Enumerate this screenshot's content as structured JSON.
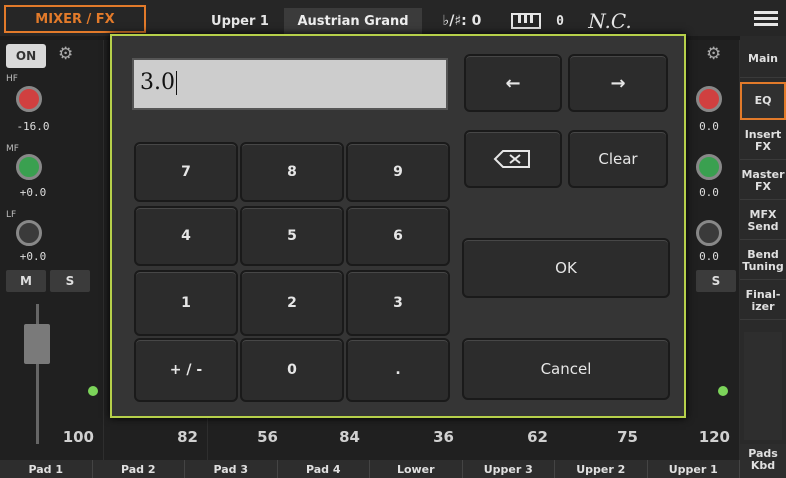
{
  "topbar": {
    "mode": "MIXER / FX",
    "keyboard_part": "Upper 1",
    "sound_name": "Austrian Grand",
    "transpose_label": "♭/♯: 0",
    "octave_value": "0",
    "chord": "N.C."
  },
  "strips": [
    {
      "on_label": "ON",
      "hf_label": "HF",
      "hf_value": "-16.0",
      "mf_label": "MF",
      "mf_value": "+0.0",
      "lf_label": "LF",
      "lf_value": "+0.0",
      "m_label": "M",
      "s_label": "S",
      "volume": "100",
      "name": "Pad 1"
    },
    {
      "volume": "82",
      "name": "Pad 2"
    },
    {
      "volume": "56",
      "name": "Pad 3"
    },
    {
      "volume": "84",
      "name": "Pad 4"
    },
    {
      "volume": "36",
      "name": "Lower"
    },
    {
      "volume": "62",
      "name": "Upper 3"
    },
    {
      "volume": "75",
      "name": "Upper 2"
    },
    {
      "hf_value": "0.0",
      "mf_value": "0.0",
      "lf_value": "0.0",
      "s_label": "S",
      "volume": "120",
      "name": "Upper 1"
    }
  ],
  "sidebar": {
    "items": [
      "Main",
      "EQ",
      "Insert FX",
      "Master FX",
      "MFX Send",
      "Bend Tuning",
      "Final-izer"
    ],
    "active": "EQ",
    "pads_kbd": "Pads Kbd"
  },
  "dialog": {
    "value": "3.0",
    "keys": {
      "k7": "7",
      "k8": "8",
      "k9": "9",
      "k4": "4",
      "k5": "5",
      "k6": "6",
      "k1": "1",
      "k2": "2",
      "k3": "3",
      "sign": "+ / -",
      "k0": "0",
      "dot": "."
    },
    "left_arrow": "←",
    "right_arrow": "→",
    "clear_label": "Clear",
    "ok_label": "OK",
    "cancel_label": "Cancel"
  },
  "colors": {
    "accent": "#e27a2a",
    "dialog_border": "#b6d04a"
  }
}
